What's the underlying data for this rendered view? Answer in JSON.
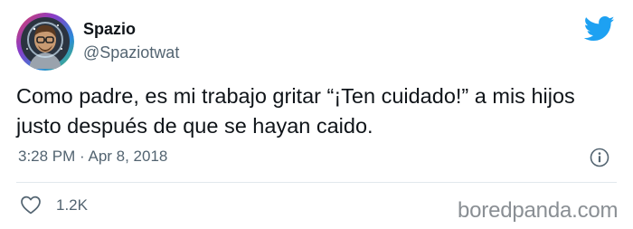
{
  "tweet": {
    "display_name": "Spazio",
    "handle": "@Spaziotwat",
    "text": "Como padre, es mi trabajo gritar “¡Ten cuidado!” a mis hijos justo después de que se hayan caido.",
    "timestamp": "3:28 PM · Apr 8, 2018",
    "like_count": "1.2K"
  },
  "watermark": "boredpanda.com",
  "icons": {
    "avatar": "avatar-illustration",
    "brand": "twitter-bird-icon",
    "info": "info-icon",
    "like": "heart-icon"
  },
  "colors": {
    "twitter_blue": "#1da1f2",
    "text_primary": "#0f1419",
    "text_secondary": "#536471",
    "divider": "#e1e8ed"
  }
}
